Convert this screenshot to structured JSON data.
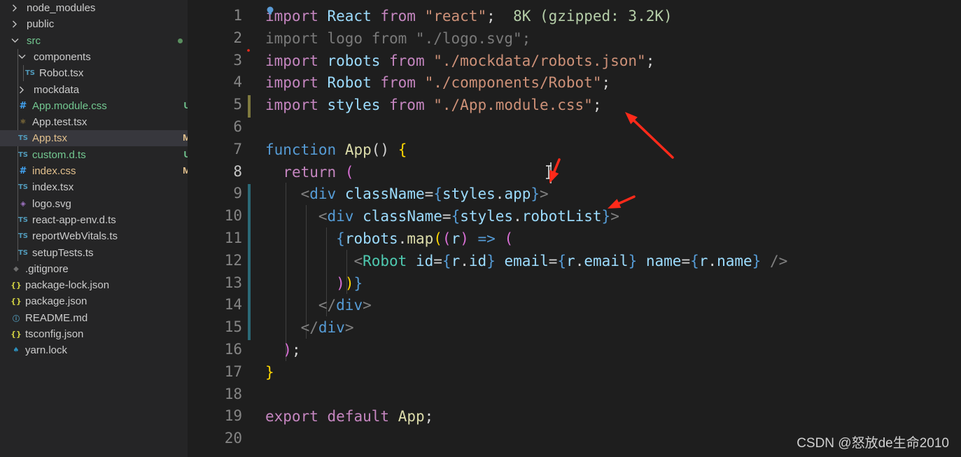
{
  "explorer": {
    "items": [
      {
        "label": "node_modules",
        "kind": "folder",
        "expanded": false,
        "depth": 0,
        "color": "#cccccc"
      },
      {
        "label": "public",
        "kind": "folder",
        "expanded": false,
        "depth": 0,
        "color": "#cccccc"
      },
      {
        "label": "src",
        "kind": "folder",
        "expanded": true,
        "depth": 0,
        "color": "#73c991",
        "dot": true
      },
      {
        "label": "components",
        "kind": "folder",
        "expanded": true,
        "depth": 1,
        "color": "#cccccc"
      },
      {
        "label": "Robot.tsx",
        "kind": "ts",
        "depth": 2,
        "color": "#cccccc",
        "icon": "TS"
      },
      {
        "label": "mockdata",
        "kind": "folder",
        "expanded": false,
        "depth": 1,
        "color": "#cccccc"
      },
      {
        "label": "App.module.css",
        "kind": "css",
        "depth": 1,
        "color": "#73c991",
        "icon": "#",
        "badge": "U"
      },
      {
        "label": "App.test.tsx",
        "kind": "react",
        "depth": 1,
        "color": "#cccccc",
        "icon": "⚛"
      },
      {
        "label": "App.tsx",
        "kind": "ts",
        "depth": 1,
        "color": "#e2c08d",
        "icon": "TS",
        "badge": "M",
        "selected": true
      },
      {
        "label": "custom.d.ts",
        "kind": "ts",
        "depth": 1,
        "color": "#73c991",
        "icon": "TS",
        "badge": "U"
      },
      {
        "label": "index.css",
        "kind": "css",
        "depth": 1,
        "color": "#e2c08d",
        "icon": "#",
        "badge": "M"
      },
      {
        "label": "index.tsx",
        "kind": "ts",
        "depth": 1,
        "color": "#cccccc",
        "icon": "TS"
      },
      {
        "label": "logo.svg",
        "kind": "svg",
        "depth": 1,
        "color": "#cccccc",
        "icon": "◈"
      },
      {
        "label": "react-app-env.d.ts",
        "kind": "ts",
        "depth": 1,
        "color": "#cccccc",
        "icon": "TS"
      },
      {
        "label": "reportWebVitals.ts",
        "kind": "ts",
        "depth": 1,
        "color": "#cccccc",
        "icon": "TS"
      },
      {
        "label": "setupTests.ts",
        "kind": "ts",
        "depth": 1,
        "color": "#cccccc",
        "icon": "TS"
      },
      {
        "label": ".gitignore",
        "kind": "git",
        "depth": 0,
        "color": "#cccccc",
        "icon": "◆"
      },
      {
        "label": "package-lock.json",
        "kind": "json",
        "depth": 0,
        "color": "#cccccc",
        "icon": "{}"
      },
      {
        "label": "package.json",
        "kind": "json",
        "depth": 0,
        "color": "#cccccc",
        "icon": "{}"
      },
      {
        "label": "README.md",
        "kind": "info",
        "depth": 0,
        "color": "#cccccc",
        "icon": "ⓘ"
      },
      {
        "label": "tsconfig.json",
        "kind": "json",
        "depth": 0,
        "color": "#cccccc",
        "icon": "{}"
      },
      {
        "label": "yarn.lock",
        "kind": "yarn",
        "depth": 0,
        "color": "#cccccc",
        "icon": "♠"
      }
    ]
  },
  "editor": {
    "lines": [
      [
        {
          "t": "import",
          "c": "#c586c0"
        },
        {
          "t": " React ",
          "c": "#9cdcfe"
        },
        {
          "t": "from",
          "c": "#c586c0"
        },
        {
          "t": " ",
          "c": "#d4d4d4"
        },
        {
          "t": "\"react\"",
          "c": "#ce9178"
        },
        {
          "t": ";",
          "c": "#d4d4d4"
        },
        {
          "t": "  8K (gzipped: 3.2K)",
          "c": "#b5cea8"
        }
      ],
      [
        {
          "t": "import logo from \"./logo.svg\";",
          "c": "#7a7a7a"
        }
      ],
      [
        {
          "t": "import",
          "c": "#c586c0"
        },
        {
          "t": " robots ",
          "c": "#9cdcfe"
        },
        {
          "t": "from",
          "c": "#c586c0"
        },
        {
          "t": " ",
          "c": "#d4d4d4"
        },
        {
          "t": "\"./mockdata/robots.json\"",
          "c": "#ce9178"
        },
        {
          "t": ";",
          "c": "#d4d4d4"
        }
      ],
      [
        {
          "t": "import",
          "c": "#c586c0"
        },
        {
          "t": " Robot ",
          "c": "#9cdcfe"
        },
        {
          "t": "from",
          "c": "#c586c0"
        },
        {
          "t": " ",
          "c": "#d4d4d4"
        },
        {
          "t": "\"./components/Robot\"",
          "c": "#ce9178"
        },
        {
          "t": ";",
          "c": "#d4d4d4"
        }
      ],
      [
        {
          "t": "import",
          "c": "#c586c0"
        },
        {
          "t": " styles ",
          "c": "#9cdcfe"
        },
        {
          "t": "from",
          "c": "#c586c0"
        },
        {
          "t": " ",
          "c": "#d4d4d4"
        },
        {
          "t": "\"./App.module.css\"",
          "c": "#ce9178"
        },
        {
          "t": ";",
          "c": "#d4d4d4"
        }
      ],
      [],
      [
        {
          "t": "function",
          "c": "#569cd6"
        },
        {
          "t": " ",
          "c": "#d4d4d4"
        },
        {
          "t": "App",
          "c": "#dcdcaa"
        },
        {
          "t": "() ",
          "c": "#d4d4d4"
        },
        {
          "t": "{",
          "c": "#ffd700"
        }
      ],
      [
        {
          "t": "  ",
          "c": "#d4d4d4"
        },
        {
          "t": "return",
          "c": "#c586c0"
        },
        {
          "t": " ",
          "c": "#d4d4d4"
        },
        {
          "t": "(",
          "c": "#da70d6"
        }
      ],
      [
        {
          "t": "    ",
          "c": "#d4d4d4"
        },
        {
          "t": "<",
          "c": "#808080"
        },
        {
          "t": "div",
          "c": "#569cd6"
        },
        {
          "t": " ",
          "c": "#d4d4d4"
        },
        {
          "t": "className",
          "c": "#9cdcfe"
        },
        {
          "t": "=",
          "c": "#d4d4d4"
        },
        {
          "t": "{",
          "c": "#569cd6"
        },
        {
          "t": "styles",
          "c": "#9cdcfe"
        },
        {
          "t": ".",
          "c": "#d4d4d4"
        },
        {
          "t": "app",
          "c": "#9cdcfe"
        },
        {
          "t": "}",
          "c": "#569cd6"
        },
        {
          "t": ">",
          "c": "#808080"
        }
      ],
      [
        {
          "t": "      ",
          "c": "#d4d4d4"
        },
        {
          "t": "<",
          "c": "#808080"
        },
        {
          "t": "div",
          "c": "#569cd6"
        },
        {
          "t": " ",
          "c": "#d4d4d4"
        },
        {
          "t": "className",
          "c": "#9cdcfe"
        },
        {
          "t": "=",
          "c": "#d4d4d4"
        },
        {
          "t": "{",
          "c": "#569cd6"
        },
        {
          "t": "styles",
          "c": "#9cdcfe"
        },
        {
          "t": ".",
          "c": "#d4d4d4"
        },
        {
          "t": "robotList",
          "c": "#9cdcfe"
        },
        {
          "t": "}",
          "c": "#569cd6"
        },
        {
          "t": ">",
          "c": "#808080"
        }
      ],
      [
        {
          "t": "        ",
          "c": "#d4d4d4"
        },
        {
          "t": "{",
          "c": "#569cd6"
        },
        {
          "t": "robots",
          "c": "#9cdcfe"
        },
        {
          "t": ".",
          "c": "#d4d4d4"
        },
        {
          "t": "map",
          "c": "#dcdcaa"
        },
        {
          "t": "(",
          "c": "#ffd700"
        },
        {
          "t": "(",
          "c": "#da70d6"
        },
        {
          "t": "r",
          "c": "#9cdcfe"
        },
        {
          "t": ") ",
          "c": "#da70d6"
        },
        {
          "t": "=>",
          "c": "#569cd6"
        },
        {
          "t": " ",
          "c": "#d4d4d4"
        },
        {
          "t": "(",
          "c": "#da70d6"
        }
      ],
      [
        {
          "t": "          ",
          "c": "#d4d4d4"
        },
        {
          "t": "<",
          "c": "#808080"
        },
        {
          "t": "Robot",
          "c": "#4ec9b0"
        },
        {
          "t": " ",
          "c": "#d4d4d4"
        },
        {
          "t": "id",
          "c": "#9cdcfe"
        },
        {
          "t": "=",
          "c": "#d4d4d4"
        },
        {
          "t": "{",
          "c": "#569cd6"
        },
        {
          "t": "r",
          "c": "#9cdcfe"
        },
        {
          "t": ".",
          "c": "#d4d4d4"
        },
        {
          "t": "id",
          "c": "#9cdcfe"
        },
        {
          "t": "}",
          "c": "#569cd6"
        },
        {
          "t": " ",
          "c": "#d4d4d4"
        },
        {
          "t": "email",
          "c": "#9cdcfe"
        },
        {
          "t": "=",
          "c": "#d4d4d4"
        },
        {
          "t": "{",
          "c": "#569cd6"
        },
        {
          "t": "r",
          "c": "#9cdcfe"
        },
        {
          "t": ".",
          "c": "#d4d4d4"
        },
        {
          "t": "email",
          "c": "#9cdcfe"
        },
        {
          "t": "}",
          "c": "#569cd6"
        },
        {
          "t": " ",
          "c": "#d4d4d4"
        },
        {
          "t": "name",
          "c": "#9cdcfe"
        },
        {
          "t": "=",
          "c": "#d4d4d4"
        },
        {
          "t": "{",
          "c": "#569cd6"
        },
        {
          "t": "r",
          "c": "#9cdcfe"
        },
        {
          "t": ".",
          "c": "#d4d4d4"
        },
        {
          "t": "name",
          "c": "#9cdcfe"
        },
        {
          "t": "}",
          "c": "#569cd6"
        },
        {
          "t": " />",
          "c": "#808080"
        }
      ],
      [
        {
          "t": "        ",
          "c": "#d4d4d4"
        },
        {
          "t": ")",
          "c": "#da70d6"
        },
        {
          "t": ")",
          "c": "#ffd700"
        },
        {
          "t": "}",
          "c": "#569cd6"
        }
      ],
      [
        {
          "t": "      ",
          "c": "#d4d4d4"
        },
        {
          "t": "</",
          "c": "#808080"
        },
        {
          "t": "div",
          "c": "#569cd6"
        },
        {
          "t": ">",
          "c": "#808080"
        }
      ],
      [
        {
          "t": "    ",
          "c": "#d4d4d4"
        },
        {
          "t": "</",
          "c": "#808080"
        },
        {
          "t": "div",
          "c": "#569cd6"
        },
        {
          "t": ">",
          "c": "#808080"
        }
      ],
      [
        {
          "t": "  ",
          "c": "#d4d4d4"
        },
        {
          "t": ")",
          "c": "#da70d6"
        },
        {
          "t": ";",
          "c": "#d4d4d4"
        }
      ],
      [
        {
          "t": "}",
          "c": "#ffd700"
        }
      ],
      [],
      [
        {
          "t": "export",
          "c": "#c586c0"
        },
        {
          "t": " ",
          "c": "#d4d4d4"
        },
        {
          "t": "default",
          "c": "#c586c0"
        },
        {
          "t": " ",
          "c": "#d4d4d4"
        },
        {
          "t": "App",
          "c": "#dcdcaa"
        },
        {
          "t": ";",
          "c": "#d4d4d4"
        }
      ],
      []
    ],
    "modified_lines": [
      5,
      9,
      10,
      11,
      12,
      13,
      14,
      15
    ],
    "annotation_color": "#ff2a1a"
  },
  "watermark": "CSDN @怒放de生命2010"
}
